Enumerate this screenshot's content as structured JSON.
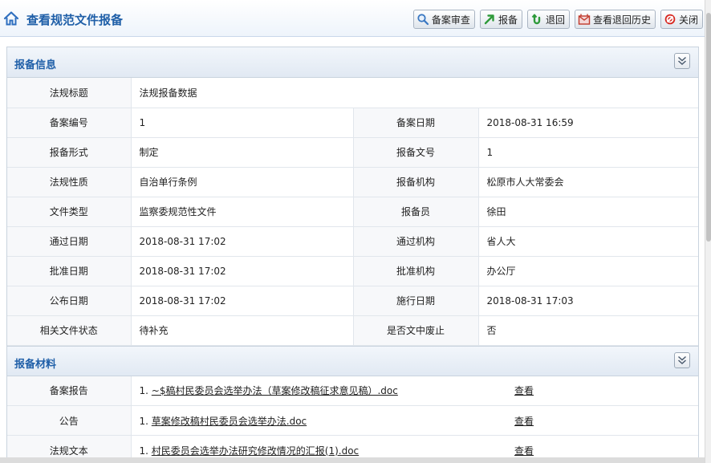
{
  "header": {
    "title": "查看规范文件报备",
    "buttons": [
      {
        "label": "备案审查",
        "icon": "search-icon"
      },
      {
        "label": "报备",
        "icon": "arrow-up-right-icon"
      },
      {
        "label": "退回",
        "icon": "undo-icon"
      },
      {
        "label": "查看退回历史",
        "icon": "history-icon"
      },
      {
        "label": "关闭",
        "icon": "close-icon"
      }
    ]
  },
  "info_section": {
    "title": "报备信息",
    "regulation_title_label": "法规标题",
    "regulation_title_value": "法规报备数据",
    "rows": [
      {
        "l1": "备案编号",
        "v1": "1",
        "l2": "备案日期",
        "v2": "2018-08-31 16:59"
      },
      {
        "l1": "报备形式",
        "v1": "制定",
        "l2": "报备文号",
        "v2": "1"
      },
      {
        "l1": "法规性质",
        "v1": "自治单行条例",
        "l2": "报备机构",
        "v2": "松原市人大常委会"
      },
      {
        "l1": "文件类型",
        "v1": "监察委规范性文件",
        "l2": "报备员",
        "v2": "徐田"
      },
      {
        "l1": "通过日期",
        "v1": "2018-08-31 17:02",
        "l2": "通过机构",
        "v2": "省人大"
      },
      {
        "l1": "批准日期",
        "v1": "2018-08-31 17:02",
        "l2": "批准机构",
        "v2": "办公厅"
      },
      {
        "l1": "公布日期",
        "v1": "2018-08-31 17:02",
        "l2": "施行日期",
        "v2": "2018-08-31 17:03"
      },
      {
        "l1": "相关文件状态",
        "v1": "待补充",
        "l2": "是否文中废止",
        "v2": "否"
      }
    ]
  },
  "materials_section": {
    "title": "报备材料",
    "items": [
      {
        "label": "备案报告",
        "index": "1.",
        "file": "~$稿村民委员会选举办法（草案修改稿征求意见稿）.doc",
        "action": "查看"
      },
      {
        "label": "公告",
        "index": "1.",
        "file": "草案修改稿村民委员会选举办法.doc",
        "action": "查看"
      },
      {
        "label": "法规文本",
        "index": "1.",
        "file": "村民委员会选举办法研究修改情况的汇报(1).doc",
        "action": "查看"
      }
    ]
  },
  "colors": {
    "accent": "#1f5fa8",
    "label_bg": "#f7f8fa",
    "border": "#e1e6ec"
  }
}
